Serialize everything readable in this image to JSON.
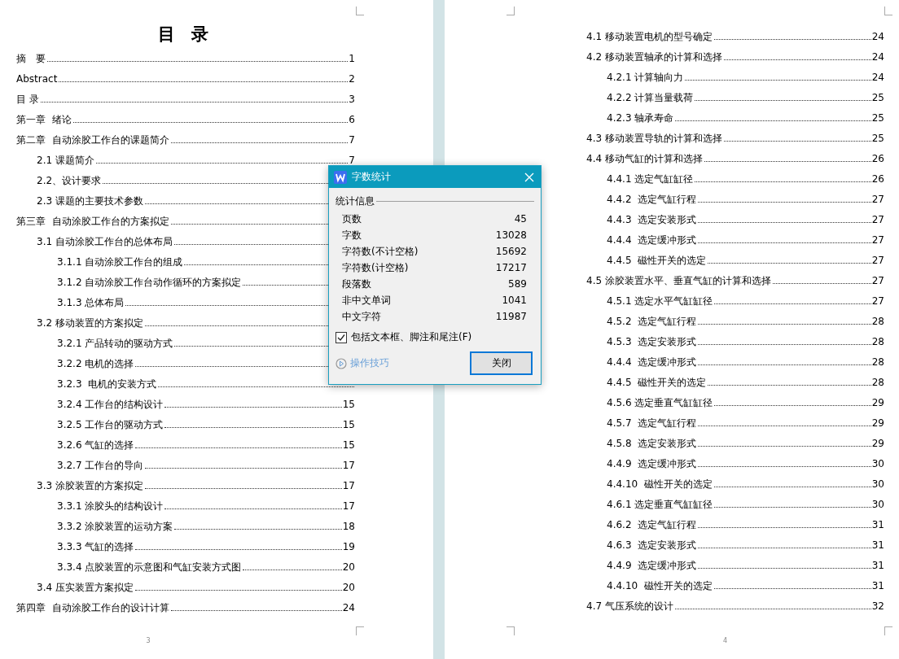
{
  "pages": [
    {
      "title": "目 录",
      "footer": "3",
      "entries": [
        {
          "label": "摘　要",
          "page": "1"
        },
        {
          "label": "Abstract",
          "page": "2"
        },
        {
          "label": "目 录",
          "page": "3"
        },
        {
          "label": "第一章  绪论",
          "page": "6"
        },
        {
          "label": "第二章  自动涂胶工作台的课题简介",
          "page": "7",
          "children": [
            {
              "label": "2.1 课题简介",
              "page": "7"
            },
            {
              "label": "2.2、设计要求"
            },
            {
              "label": "2.3 课题的主要技术参数"
            }
          ]
        },
        {
          "label": "第三章  自动涂胶工作台的方案拟定",
          "children": [
            {
              "label": "3.1 自动涂胶工作台的总体布局",
              "children": [
                {
                  "label": "3.1.1 自动涂胶工作台的组成"
                },
                {
                  "label": "3.1.2 自动涂胶工作台动作循环的方案拟定"
                },
                {
                  "label": "3.1.3 总体布局"
                }
              ]
            },
            {
              "label": "3.2 移动装置的方案拟定",
              "children": [
                {
                  "label": "3.2.1 产品转动的驱动方式"
                },
                {
                  "label": "3.2.2 电机的选择"
                },
                {
                  "label": "3.2.3  电机的安装方式"
                },
                {
                  "label": "3.2.4 工作台的结构设计",
                  "page": "15"
                },
                {
                  "label": "3.2.5 工作台的驱动方式",
                  "page": "15"
                },
                {
                  "label": "3.2.6 气缸的选择",
                  "page": "15"
                },
                {
                  "label": "3.2.7 工作台的导向",
                  "page": "17"
                }
              ]
            },
            {
              "label": "3.3 涂胶装置的方案拟定",
              "page": "17",
              "children": [
                {
                  "label": "3.3.1 涂胶头的结构设计",
                  "page": "17"
                },
                {
                  "label": "3.3.2 涂胶装置的运动方案",
                  "page": "18"
                },
                {
                  "label": "3.3.3 气缸的选择",
                  "page": "19"
                },
                {
                  "label": "3.3.4 点胶装置的示意图和气缸安装方式图",
                  "page": "20"
                }
              ]
            },
            {
              "label": "3.4 压实装置方案拟定",
              "page": "20"
            }
          ]
        },
        {
          "label": "第四章  自动涂胶工作台的设计计算",
          "page": "24"
        }
      ]
    },
    {
      "footer": "4",
      "entries": [
        {
          "label": "4.1 移动装置电机的型号确定",
          "page": "24"
        },
        {
          "label": "4.2 移动装置轴承的计算和选择",
          "page": "24",
          "children": [
            {
              "label": "4.2.1 计算轴向力",
              "page": "24"
            },
            {
              "label": "4.2.2 计算当量载荷",
              "page": "25"
            },
            {
              "label": "4.2.3 轴承寿命",
              "page": "25"
            }
          ]
        },
        {
          "label": "4.3 移动装置导轨的计算和选择",
          "page": "25"
        },
        {
          "label": "4.4 移动气缸的计算和选择",
          "page": "26",
          "children": [
            {
              "label": "4.4.1 选定气缸缸径",
              "page": "26"
            },
            {
              "label": "4.4.2  选定气缸行程",
              "page": "27"
            },
            {
              "label": "4.4.3  选定安装形式",
              "page": "27"
            },
            {
              "label": "4.4.4  选定缓冲形式",
              "page": "27"
            },
            {
              "label": "4.4.5  磁性开关的选定",
              "page": "27"
            }
          ]
        },
        {
          "label": "4.5 涂胶装置水平、垂直气缸的计算和选择",
          "page": "27",
          "children": [
            {
              "label": "4.5.1 选定水平气缸缸径",
              "page": "27"
            },
            {
              "label": "4.5.2  选定气缸行程",
              "page": "28"
            },
            {
              "label": "4.5.3  选定安装形式",
              "page": "28"
            },
            {
              "label": "4.4.4  选定缓冲形式",
              "page": "28"
            },
            {
              "label": "4.4.5  磁性开关的选定",
              "page": "28"
            },
            {
              "label": "4.5.6 选定垂直气缸缸径",
              "page": "29"
            },
            {
              "label": "4.5.7  选定气缸行程",
              "page": "29"
            },
            {
              "label": "4.5.8  选定安装形式",
              "page": "29"
            },
            {
              "label": "4.4.9  选定缓冲形式",
              "page": "30"
            },
            {
              "label": "4.4.10  磁性开关的选定",
              "page": "30"
            },
            {
              "label": "4.6.1 选定垂直气缸缸径",
              "page": "30"
            },
            {
              "label": "4.6.2  选定气缸行程",
              "page": "31"
            },
            {
              "label": "4.6.3  选定安装形式",
              "page": "31"
            },
            {
              "label": "4.4.9  选定缓冲形式",
              "page": "31"
            },
            {
              "label": "4.4.10  磁性开关的选定",
              "page": "31"
            }
          ]
        },
        {
          "label": "4.7 气压系统的设计",
          "page": "32"
        }
      ]
    }
  ],
  "dialog": {
    "title": "字数统计",
    "group": "统计信息",
    "stats": [
      {
        "label": "页数",
        "value": "45"
      },
      {
        "label": "字数",
        "value": "13028"
      },
      {
        "label": "字符数(不计空格)",
        "value": "15692"
      },
      {
        "label": "字符数(计空格)",
        "value": "17217"
      },
      {
        "label": "段落数",
        "value": "589"
      },
      {
        "label": "非中文单词",
        "value": "1041"
      },
      {
        "label": "中文字符",
        "value": "11987"
      }
    ],
    "checkbox": {
      "label": "包括文本框、脚注和尾注(F)",
      "checked": true
    },
    "tips_link": "操作技巧",
    "close_button": "关闭"
  }
}
